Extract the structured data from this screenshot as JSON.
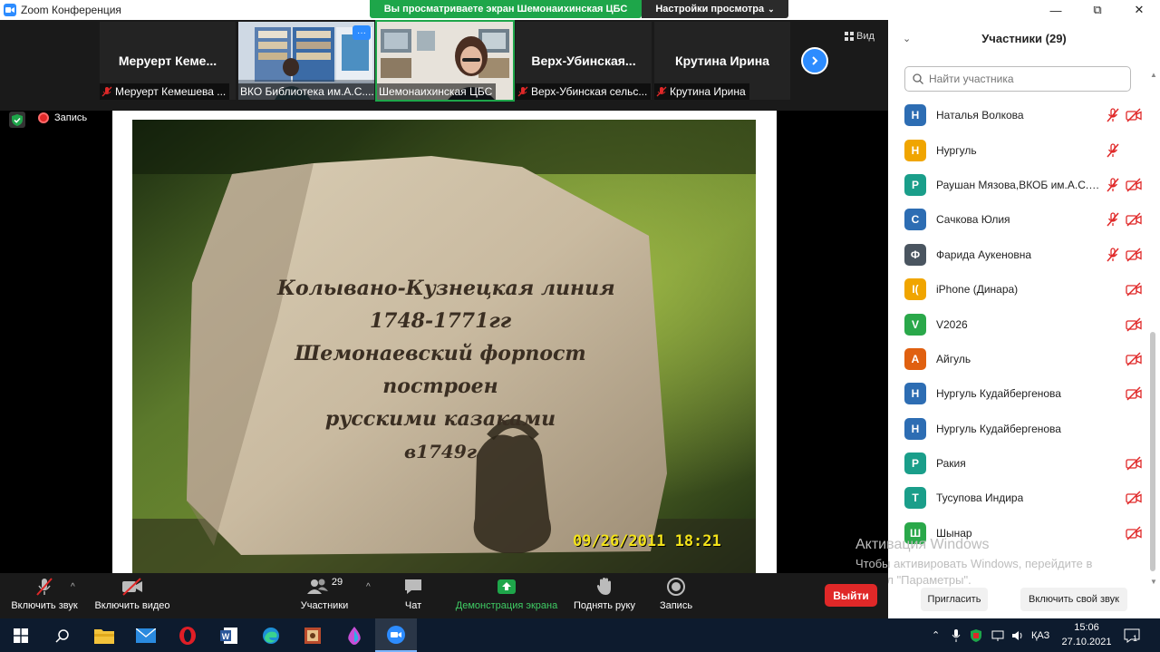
{
  "window": {
    "title": "Zoom Конференция",
    "share_banner": "Вы просматриваете экран Шемонаихинская ЦБС",
    "view_settings": "Настройки просмотра",
    "view_label": "Вид"
  },
  "video_strip": {
    "tiles": [
      {
        "name": "Меруерт  Кеме...",
        "label": "Меруерт Кемешева ..."
      },
      {
        "name": "",
        "label": "ВКО Библиотека им.А.С...."
      },
      {
        "name": "",
        "label": "Шемонаихинская ЦБС"
      },
      {
        "name": "Верх-Убинская...",
        "label": "Верх-Убинская сельс..."
      },
      {
        "name": "Крутина Ирина",
        "label": "Крутина Ирина"
      }
    ],
    "more_badge": "···"
  },
  "recording": {
    "label": "Запись"
  },
  "shared_content": {
    "stone_lines": [
      "Колывано-Кузнецкая линия",
      "1748-1771гг",
      "Шемонаевский форпост",
      "построен",
      "русскими казаками",
      "в1749г"
    ],
    "timestamp": "09/26/2011 18:21"
  },
  "participants": {
    "title": "Участники (29)",
    "search_placeholder": "Найти участника",
    "list": [
      {
        "initial": "Н",
        "name": "Наталья Волкова",
        "color": "#2d6db3",
        "mic_muted": true,
        "video_off": true
      },
      {
        "initial": "Н",
        "name": "Нургуль",
        "color": "#f0a500",
        "mic_muted": true,
        "video_off": false
      },
      {
        "initial": "Р",
        "name": "Раушан Мязова,ВКОБ им.А.С.П...",
        "color": "#1a9e8a",
        "mic_muted": true,
        "video_off": true
      },
      {
        "initial": "С",
        "name": "Сачкова Юлия",
        "color": "#2d6db3",
        "mic_muted": true,
        "video_off": true
      },
      {
        "initial": "Ф",
        "name": "Фарида Аукеновна",
        "color": "#4a5560",
        "mic_muted": true,
        "video_off": true
      },
      {
        "initial": "I(",
        "name": "iPhone (Динара)",
        "color": "#f0a500",
        "mic_muted": false,
        "video_off": true
      },
      {
        "initial": "V",
        "name": "V2026",
        "color": "#2aa84a",
        "mic_muted": false,
        "video_off": true
      },
      {
        "initial": "А",
        "name": "Айгуль",
        "color": "#e06010",
        "mic_muted": false,
        "video_off": true
      },
      {
        "initial": "Н",
        "name": "Нургуль Кудайбергенова",
        "color": "#2d6db3",
        "mic_muted": false,
        "video_off": true
      },
      {
        "initial": "Н",
        "name": "Нургуль Кудайбергенова",
        "color": "#2d6db3",
        "mic_muted": false,
        "video_off": false
      },
      {
        "initial": "Р",
        "name": "Ракия",
        "color": "#1a9e8a",
        "mic_muted": false,
        "video_off": true
      },
      {
        "initial": "Т",
        "name": "Тусупова Индира",
        "color": "#1a9e8a",
        "mic_muted": false,
        "video_off": true
      },
      {
        "initial": "Ш",
        "name": "Шынар",
        "color": "#2aa84a",
        "mic_muted": false,
        "video_off": true
      }
    ],
    "invite_label": "Пригласить",
    "unmute_self_label": "Включить свой звук"
  },
  "watermark": {
    "line1": "Активация Windows",
    "line2": "Чтобы активировать Windows, перейдите в",
    "line3": "раздел \"Параметры\"."
  },
  "toolbar": {
    "unmute": "Включить звук",
    "start_video": "Включить видео",
    "participants": "Участники",
    "participants_count": "29",
    "chat": "Чат",
    "share_screen": "Демонстрация экрана",
    "raise_hand": "Поднять руку",
    "record": "Запись",
    "leave": "Выйти"
  },
  "taskbar": {
    "language": "ҚАЗ",
    "time": "15:06",
    "date": "27.10.2021",
    "notification_count": "1"
  }
}
